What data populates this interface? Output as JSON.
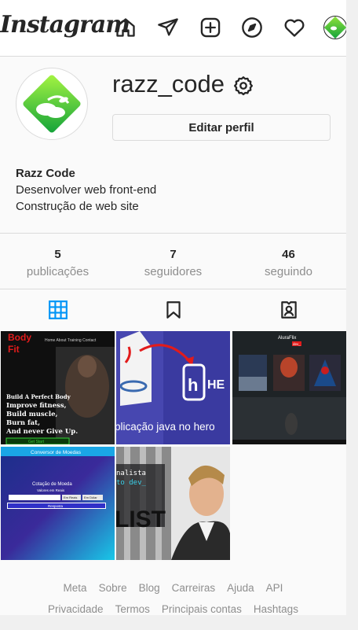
{
  "header": {
    "logo": "Instagram",
    "nav_icons": [
      "home-icon",
      "direct-icon",
      "new-post-icon",
      "explore-icon",
      "activity-icon"
    ]
  },
  "profile": {
    "username": "razz_code",
    "edit_label": "Editar perfil",
    "bio_name": "Razz Code",
    "bio_lines": [
      "Desenvolver web front-end",
      "Construção de web site"
    ],
    "avatar_colors": [
      "#7ed321",
      "#1fae3a"
    ]
  },
  "stats": [
    {
      "value": "5",
      "label": "publicações"
    },
    {
      "value": "7",
      "label": "seguidores"
    },
    {
      "value": "46",
      "label": "seguindo"
    }
  ],
  "tabs": [
    "grid-icon",
    "saved-icon",
    "tagged-icon"
  ],
  "accent": "#0095f6",
  "posts": {
    "p1": {
      "title": "Body Fit",
      "nav": "Home  About  Training  Contact",
      "heading": "Build A Perfect Body",
      "lines": [
        "Improve fitness,",
        "Build muscle,",
        "Burn fat,",
        "And never Give Up."
      ],
      "cta": "Get Start"
    },
    "p2": {
      "text": "plicação java no hero",
      "brand": "HE"
    },
    "p3": {
      "title": "AluraFlix",
      "tag": "dev_"
    },
    "p4": {
      "header": "Conversor de Moedas",
      "title": "Cotação de Moeda",
      "label": "Valores em Reais",
      "btn1": "Em Reais",
      "btn2": "Em Dólar",
      "result": "Resposta"
    },
    "p5": {
      "lines": [
        "nalista",
        "to dev_"
      ],
      "word": "LIST"
    }
  },
  "footer": {
    "row1": [
      "Meta",
      "Sobre",
      "Blog",
      "Carreiras",
      "Ajuda",
      "API"
    ],
    "row2": [
      "Privacidade",
      "Termos",
      "Principais contas",
      "Hashtags"
    ]
  }
}
